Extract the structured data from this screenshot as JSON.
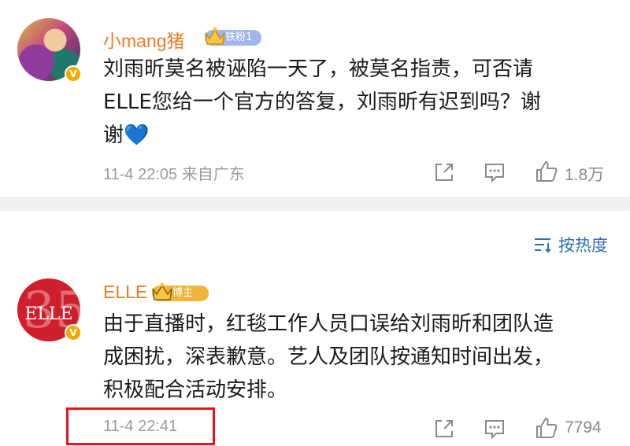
{
  "comments": [
    {
      "username": "小mang猪",
      "badge": "铁粉1",
      "content_lines": [
        "刘雨昕莫名被诬陷一天了，被莫名指责，可否请",
        "ELLE您给一个官方的答复，刘雨昕有迟到吗？谢",
        "谢"
      ],
      "content_emoji": "💙",
      "timestamp": "11-4 22:05 来自广东",
      "likes": "1.8万"
    },
    {
      "username": "ELLE",
      "badge": "博主",
      "avatar_text": "ELLE",
      "content_lines": [
        "由于直播时，红毯工作人员口误给刘雨昕和团队造",
        "成困扰，深表歉意。艺人及团队按通知时间出发，",
        "积极配合活动安排。"
      ],
      "timestamp": "11-4 22:41",
      "likes": "7794"
    }
  ],
  "sort": {
    "label": "按热度"
  },
  "colors": {
    "username": "#f07a24",
    "link": "#2f6fb6",
    "highlight": "#e4161c"
  }
}
